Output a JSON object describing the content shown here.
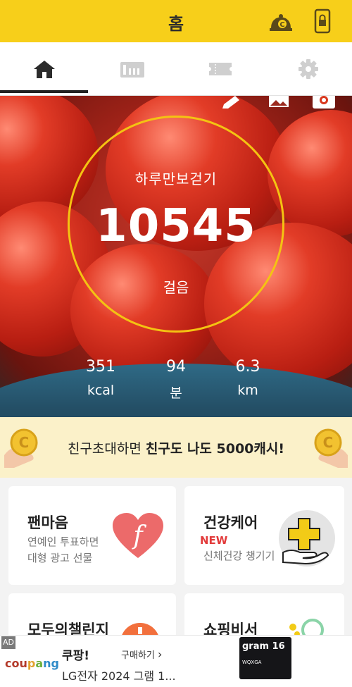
{
  "header": {
    "title": "홈",
    "icons": [
      "lamp-icon",
      "phone-lock-icon"
    ]
  },
  "tabs": [
    {
      "name": "home",
      "icon": "home-icon",
      "active": true
    },
    {
      "name": "gift",
      "icon": "gift-shop-icon",
      "active": false
    },
    {
      "name": "ticket",
      "icon": "ticket-icon",
      "active": false
    },
    {
      "name": "settings",
      "icon": "gear-icon",
      "active": false
    }
  ],
  "hero": {
    "icons": [
      "pen-icon",
      "image-icon",
      "camera-icon"
    ],
    "label": "하루만보걷기",
    "steps": "10545",
    "steps_unit": "걸음",
    "stats": [
      {
        "value": "351",
        "unit": "kcal"
      },
      {
        "value": "94",
        "unit": "분"
      },
      {
        "value": "6.3",
        "unit": "km"
      }
    ]
  },
  "banner": {
    "text_normal": "친구초대하면 ",
    "text_bold": "친구도 나도 5000캐시!"
  },
  "cards": [
    {
      "title": "팬마음",
      "line1": "연예인 투표하면",
      "line2": "대형 광고 선물",
      "icon": "heart-f-icon"
    },
    {
      "title": "건강케어",
      "new_label": "NEW",
      "line1": "신체건강 챙기기",
      "icon": "hand-plus-icon"
    },
    {
      "title": "모두의챌린지",
      "icon": "challenge-icon"
    },
    {
      "title": "쇼핑비서",
      "icon": "shopping-icon"
    }
  ],
  "ad": {
    "tag": "AD",
    "brand": [
      "cou",
      "p",
      "a",
      "ng"
    ],
    "title": "쿠팡!",
    "buy_label": "구매하기",
    "description": "LG전자 2024 그램 1...",
    "product_name": "gram 16",
    "product_model": "WQXGA"
  },
  "colors": {
    "accent": "#f7cf1a",
    "ring": "#f4c312",
    "banner": "#fbf1c9",
    "new": "#e23b3b"
  }
}
